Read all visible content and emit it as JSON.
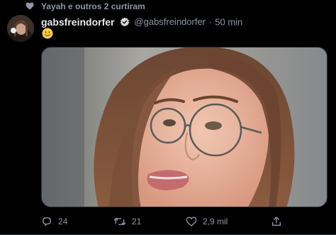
{
  "social_context": {
    "text": "Yayah e outros 2 curtiram",
    "icon": "heart-icon"
  },
  "tweet": {
    "display_name": "gabsfreindorfer",
    "handle": "@gabsfreindorfer",
    "separator": "·",
    "time": "50 min",
    "text_emoji": "slightly-smiling-face",
    "verified": true
  },
  "actions": {
    "replies": "24",
    "retweets": "21",
    "likes": "2,9 mil"
  },
  "colors": {
    "background": "#000000",
    "secondary_text": "#8b98a5",
    "verified_badge": "#d9d9d9"
  }
}
